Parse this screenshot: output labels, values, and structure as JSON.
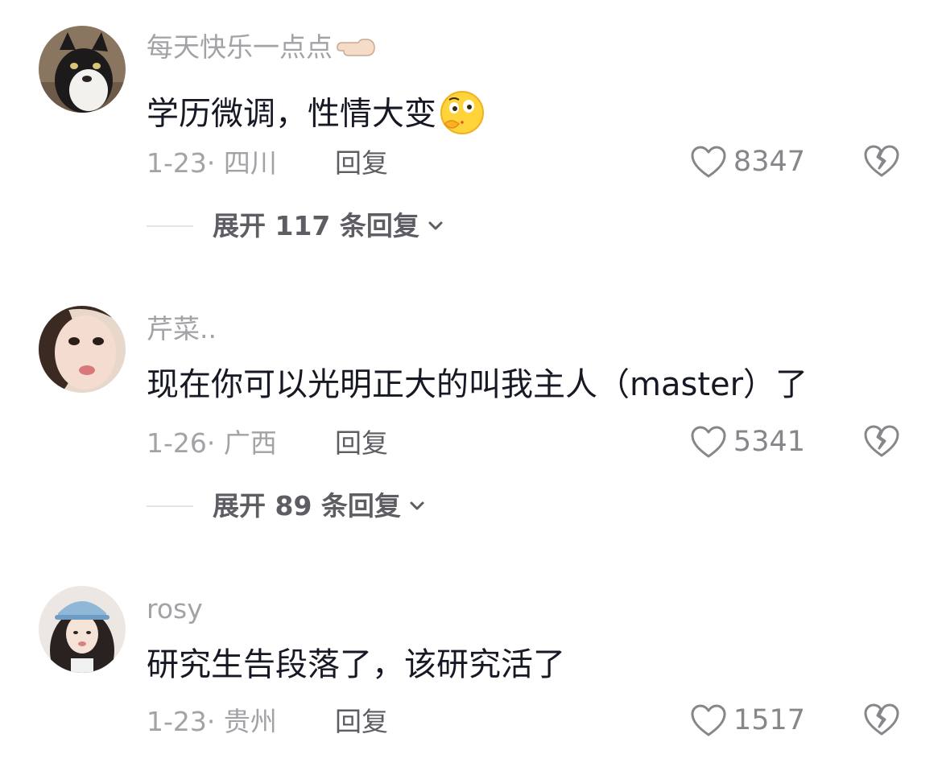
{
  "comments": [
    {
      "username": "每天快乐一点点",
      "username_emoji": "pointing-left-hand",
      "text": "学历微调，性情大变",
      "text_emoji": "thinking-face",
      "meta": "1-23· 四川",
      "reply_label": "回复",
      "likes": "8347",
      "expand_label": "展开 117 条回复",
      "avatar": "cat-avatar"
    },
    {
      "username": "芹菜..",
      "text": "现在你可以光明正大的叫我主人（master）了",
      "meta": "1-26· 广西",
      "reply_label": "回复",
      "likes": "5341",
      "expand_label": "展开 89 条回复",
      "avatar": "woman-avatar"
    },
    {
      "username": "rosy",
      "text": "研究生告段落了，该研究活了",
      "meta": "1-23· 贵州",
      "reply_label": "回复",
      "likes": "1517",
      "avatar": "woman-cap-avatar"
    }
  ],
  "colors": {
    "primary_text": "#161823",
    "secondary_text": "#a2a2a7",
    "action_text": "#5d5d63",
    "icon_stroke": "#86868b"
  }
}
